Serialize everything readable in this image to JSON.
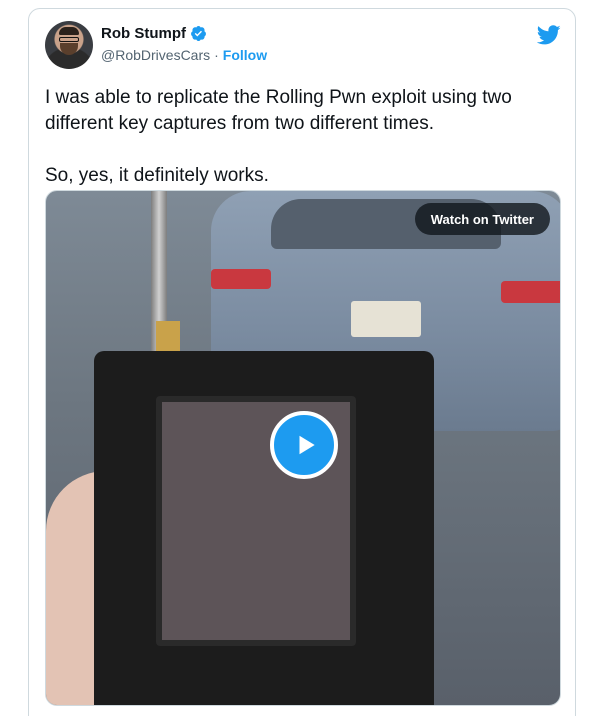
{
  "tweet": {
    "author_name": "Rob Stumpf",
    "handle": "@RobDrivesCars",
    "separator": "·",
    "follow_label": "Follow",
    "text": "I was able to replicate the Rolling Pwn exploit using two different key captures from two different times.\n\nSo, yes, it definitely works.",
    "media": {
      "watch_label": "Watch on Twitter"
    },
    "icons": {
      "verified": "verified-badge-icon",
      "brand": "twitter-bird-icon",
      "play": "play-icon"
    },
    "colors": {
      "accent": "#1d9bf0",
      "text": "#0f1419",
      "muted": "#536471",
      "border": "#cfd9de"
    }
  }
}
